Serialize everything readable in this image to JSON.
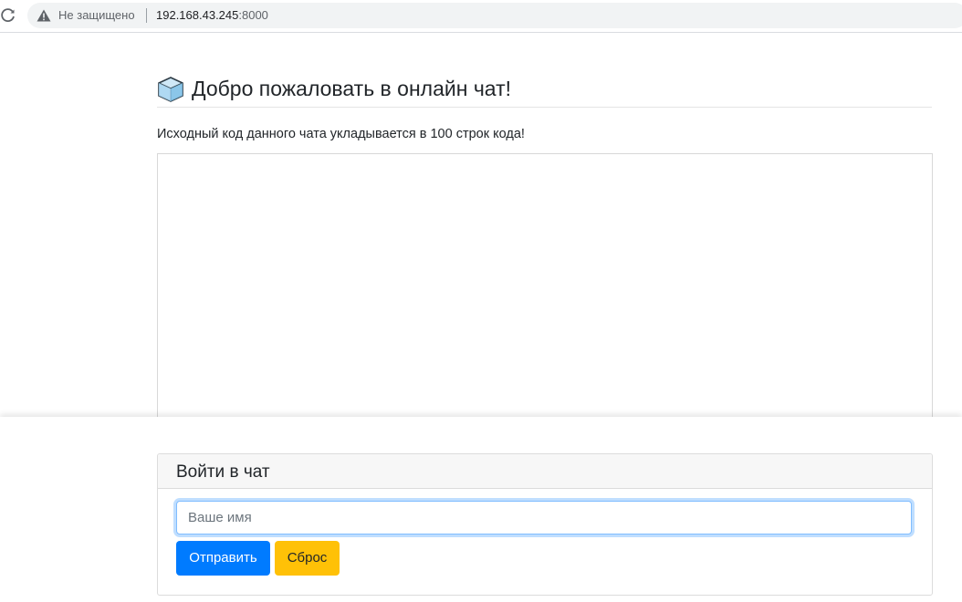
{
  "browser": {
    "security_label": "Не защищено",
    "url_host": "192.168.43.245",
    "url_port": ":8000",
    "icons": {
      "reload": "reload-icon",
      "warning": "warning-triangle-icon"
    }
  },
  "page": {
    "title": "Добро пожаловать в онлайн чат!",
    "title_icon": "cube-icon",
    "subtitle": "Исходный код данного чата укладывается в 100 строк кода!"
  },
  "login_card": {
    "title": "Войти в чат",
    "name_placeholder": "Ваше имя",
    "name_value": "",
    "send_label": "Отправить",
    "reset_label": "Сброс"
  },
  "colors": {
    "primary": "#007bff",
    "warning": "#ffc107",
    "focus_border": "#80bdff"
  }
}
